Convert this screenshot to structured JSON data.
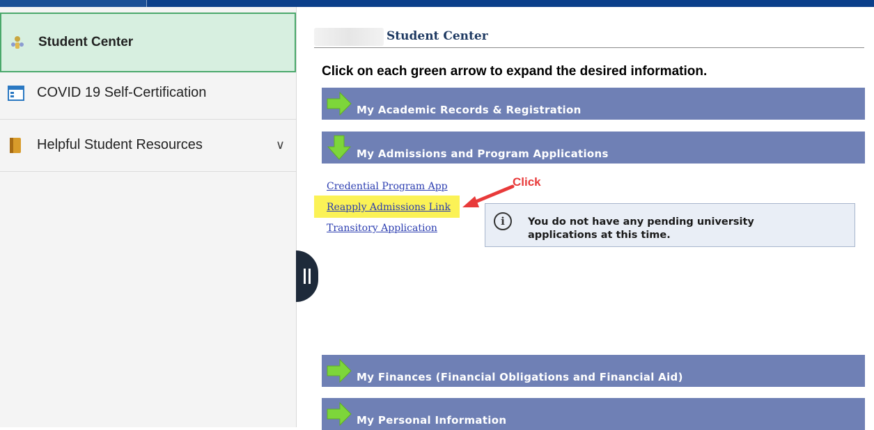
{
  "sidebar": {
    "items": [
      {
        "label": "Student Center",
        "icon": "student-center-icon",
        "active": true
      },
      {
        "label": "COVID 19 Self-Certification",
        "icon": "form-window-icon"
      },
      {
        "label": "Helpful Student Resources",
        "icon": "book-icon",
        "has_submenu": true
      }
    ]
  },
  "main": {
    "page_title": "Student Center",
    "instruction": "Click on each green arrow to expand the desired information.",
    "sections": [
      {
        "label": "My Academic Records & Registration",
        "expanded": false
      },
      {
        "label": "My Admissions and Program Applications",
        "expanded": true
      },
      {
        "label": "My Finances (Financial Obligations and Financial Aid)",
        "expanded": false
      },
      {
        "label": "My Personal Information",
        "expanded": false
      }
    ],
    "admissions_links": [
      "Credential Program App",
      "Reapply Admissions Link",
      "Transitory Application"
    ],
    "info_message": "You do not have any pending university applications at this time.",
    "annotation": "Click"
  },
  "colors": {
    "section_bar": "#6f80b5",
    "active_nav_bg": "#d7efe0",
    "highlight": "#fbf256",
    "annotation": "#e83a3a",
    "link": "#2a3cb0"
  }
}
